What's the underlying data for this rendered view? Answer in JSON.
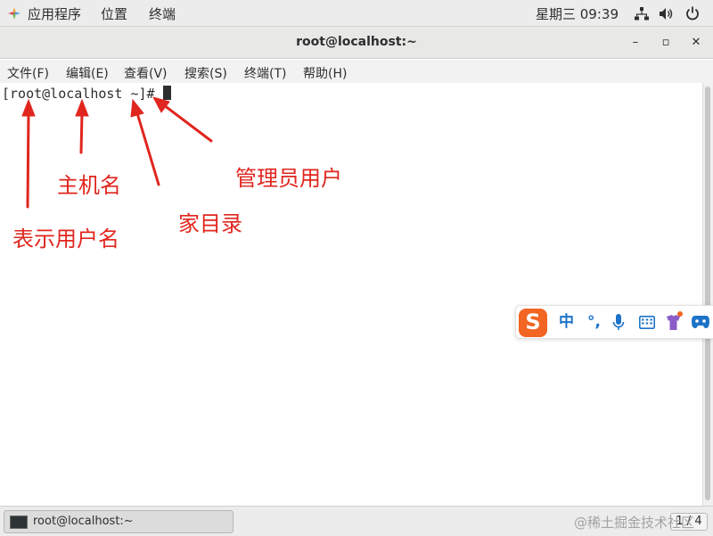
{
  "top_panel": {
    "applications": "应用程序",
    "places": "位置",
    "terminal_app": "终端",
    "clock": "星期三 09:39",
    "icons": [
      "network-icon",
      "volume-icon",
      "power-icon"
    ]
  },
  "window": {
    "title": "root@localhost:~",
    "controls": {
      "minimize": "–",
      "maximize": "▫",
      "close": "✕"
    }
  },
  "menu": {
    "items": [
      "文件(F)",
      "编辑(E)",
      "查看(V)",
      "搜索(S)",
      "终端(T)",
      "帮助(H)"
    ]
  },
  "terminal": {
    "prompt": "[root@localhost ~]# "
  },
  "annotations": {
    "username": "表示用户名",
    "hostname": "主机名",
    "home_dir": "家目录",
    "admin_user": "管理员用户",
    "color": "#e0261e"
  },
  "ime": {
    "logo": "S",
    "chinese": "中",
    "punct": "°,",
    "icons": [
      "microphone-icon",
      "keyboard-icon",
      "skin-icon",
      "gamepad-icon"
    ]
  },
  "taskbar": {
    "window_label": "root@localhost:~",
    "workspace": "1 / 4",
    "watermark": "@稀土掘金技术社区"
  }
}
